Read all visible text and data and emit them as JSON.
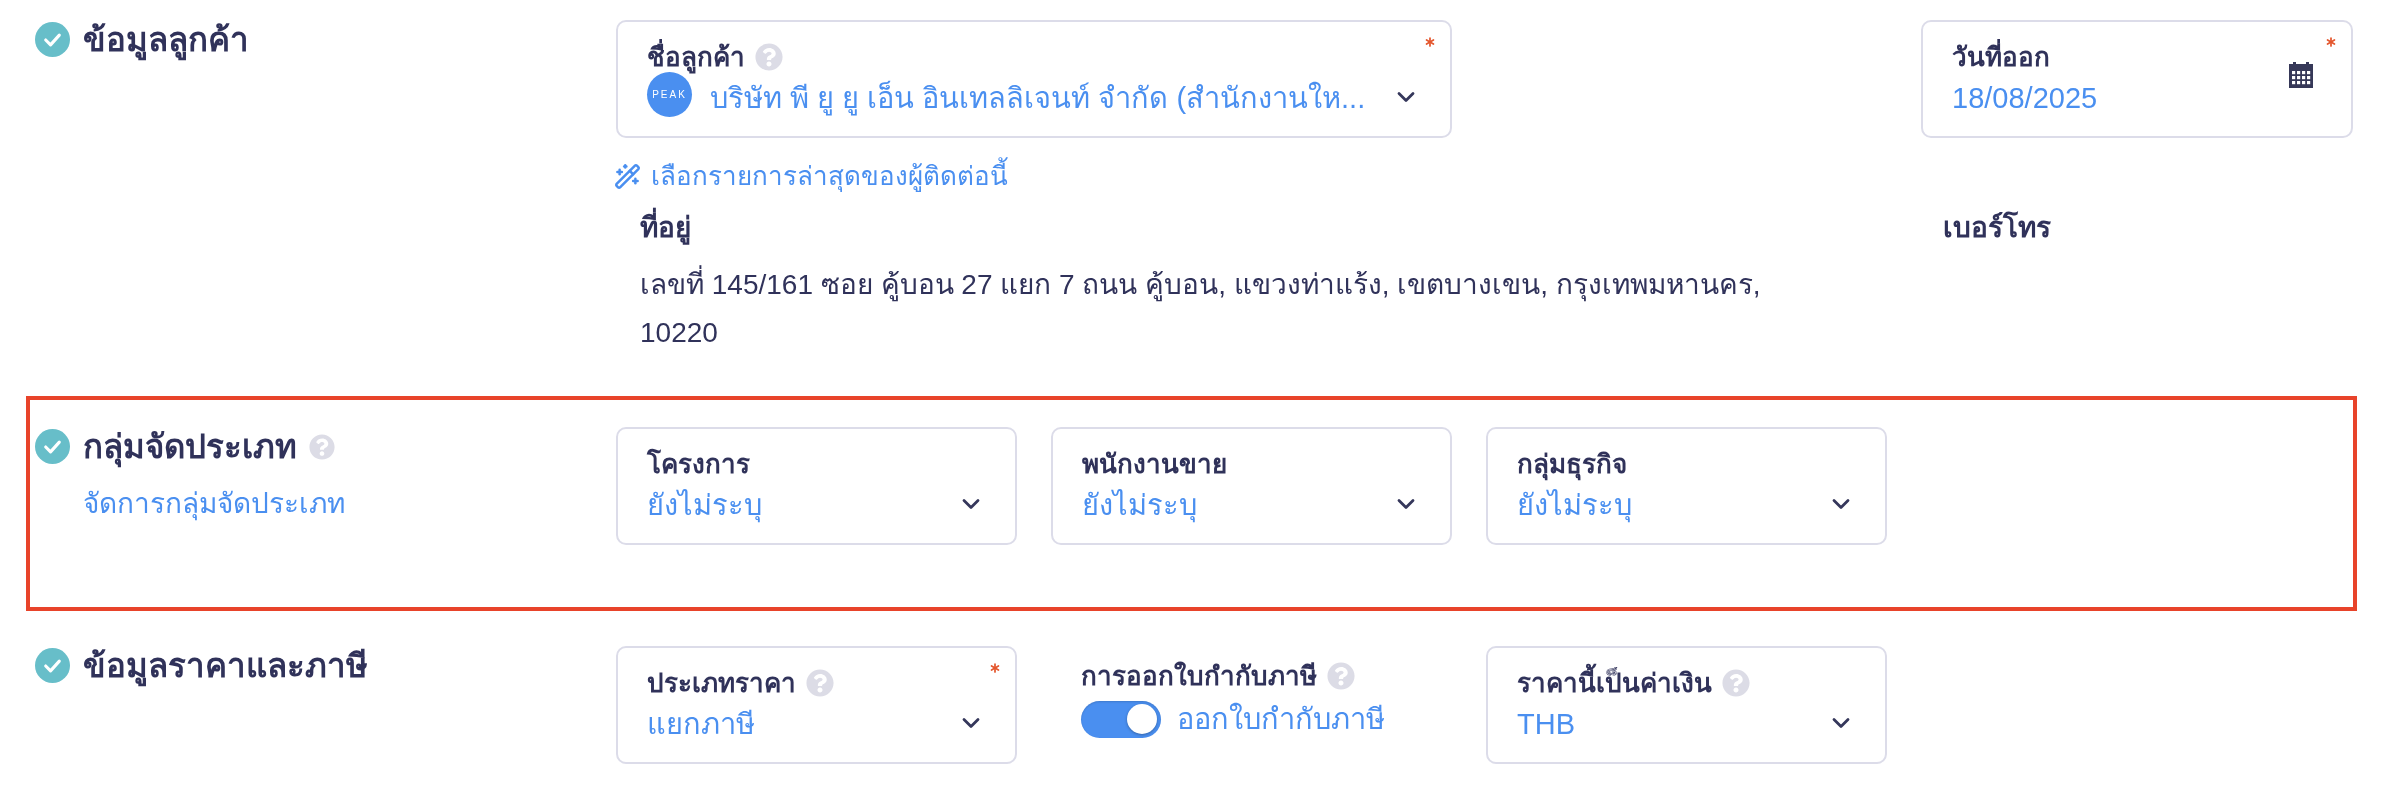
{
  "sections": [
    {
      "kind": "customer",
      "title": "ข้อมูลลูกค้า",
      "help": false,
      "completed": true,
      "highlighted": false,
      "fields": [
        {
          "kind": "customer",
          "label": "ชื่อลูกค้า",
          "help": true,
          "required": true,
          "logo_text": "PEAK",
          "value": "บริษัท พี ยู ยู เอ็น อินเทลลิเจนท์ จำกัด (สำนักงานให..."
        },
        {
          "kind": "date",
          "label": "วันที่ออก",
          "help": false,
          "required": true,
          "value": "18/08/2025"
        }
      ],
      "recent_link": "เลือกรายการล่าสุดของผู้ติดต่อนี้",
      "address": {
        "label": "ที่อยู่",
        "value": "เลขที่ 145/161 ซอย คู้บอน 27 แยก 7 ถนน คู้บอน, แขวงท่าแร้ง, เขตบางเขน, กรุงเทพมหานคร, 10220"
      },
      "phone": {
        "label": "เบอร์โทร"
      }
    },
    {
      "kind": "classification",
      "title": "กลุ่มจัดประเภท",
      "help": true,
      "completed": true,
      "highlighted": true,
      "manage_link": "จัดการกลุ่มจัดประเภท",
      "fields": [
        {
          "kind": "select",
          "label": "โครงการ",
          "help": false,
          "required": false,
          "value": "ยังไม่ระบุ"
        },
        {
          "kind": "select",
          "label": "พนักงานขาย",
          "help": false,
          "required": false,
          "value": "ยังไม่ระบุ"
        },
        {
          "kind": "select",
          "label": "กลุ่มธุรกิจ",
          "help": false,
          "required": false,
          "value": "ยังไม่ระบุ"
        }
      ]
    },
    {
      "kind": "pricing",
      "title": "ข้อมูลราคาและภาษี",
      "help": false,
      "completed": true,
      "highlighted": false,
      "fields": [
        {
          "kind": "select",
          "label": "ประเภทราคา",
          "help": true,
          "required": true,
          "value": "แยกภาษี"
        },
        {
          "kind": "toggle",
          "label": "การออกใบกำกับภาษี",
          "help": true,
          "on": true,
          "value": "ออกใบกำกับภาษี"
        },
        {
          "kind": "select",
          "label": "ราคานี้เป็นค่าเงิน",
          "help": true,
          "required": false,
          "value": "THB"
        }
      ]
    }
  ]
}
